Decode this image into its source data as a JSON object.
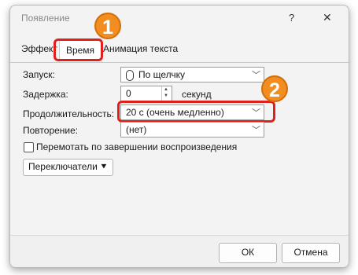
{
  "window": {
    "title": "Появление",
    "help": "?",
    "close": "✕"
  },
  "tabs": [
    {
      "label": "Эффект"
    },
    {
      "label": "Время",
      "active": true
    },
    {
      "label": "Анимация текста"
    }
  ],
  "badges": {
    "one": "1",
    "two": "2"
  },
  "form": {
    "start_label": "Запуск:",
    "start_value": "По щелчку",
    "delay_label": "Задержка:",
    "delay_value": "0",
    "delay_unit": "секунд",
    "duration_label": "Продолжительность:",
    "duration_value": "20 с (очень медленно)",
    "repeat_label": "Повторение:",
    "repeat_value": "(нет)",
    "rewind_label": "Перемотать по завершении воспроизведения",
    "triggers_label": "Переключатели"
  },
  "buttons": {
    "ok": "ОК",
    "cancel": "Отмена"
  },
  "colors": {
    "highlight": "#e0201a",
    "badge": "#f28d1f"
  }
}
